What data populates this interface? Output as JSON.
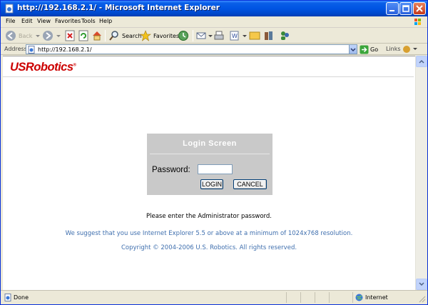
{
  "window": {
    "title": "http://192.168.2.1/ - Microsoft Internet Explorer"
  },
  "menu": [
    "File",
    "Edit",
    "View",
    "Favorites",
    "Tools",
    "Help"
  ],
  "toolbar": {
    "back": "Back",
    "search": "Search",
    "favorites": "Favorites"
  },
  "address": {
    "label": "Address",
    "url": "http://192.168.2.1/",
    "go": "Go",
    "links": "Links"
  },
  "page": {
    "logo": "USRobotics",
    "login_title": "Login  Screen",
    "password_label": "Password:",
    "password_value": "",
    "login_button": "LOGIN",
    "cancel_button": "CANCEL",
    "admin_message": "Please enter the Administrator password.",
    "suggestion": "We suggest that you use Internet Explorer 5.5 or above at a minimum of 1024x768 resolution.",
    "copyright": "Copyright © 2004-2006 U.S. Robotics. All rights reserved."
  },
  "status": {
    "text": "Done",
    "zone": "Internet"
  },
  "colors": {
    "brand_red": "#cc0000",
    "link_blue": "#3f6fae",
    "titlebar_blue": "#0054e3",
    "login_panel": "#c9c9c9"
  }
}
